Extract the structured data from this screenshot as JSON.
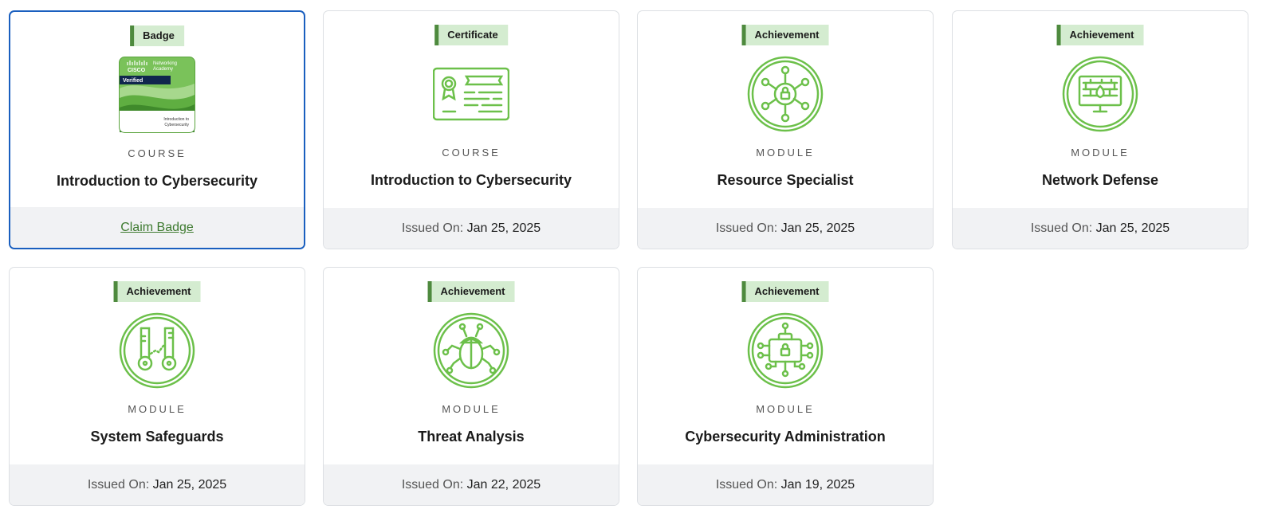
{
  "colors": {
    "accent_green": "#6cc04a",
    "tag_bg": "#d4ecd0",
    "tag_border": "#4e8a3e",
    "selected_border": "#1a5fbf",
    "link_green": "#3d7a2f"
  },
  "cards": [
    {
      "tag": "Badge",
      "icon": "cisco-verified-badge",
      "badge_brand": "Networking",
      "badge_brand2": "Academy",
      "badge_vendor": "CISCO",
      "badge_verified": "Verified",
      "badge_course1": "Introduction to",
      "badge_course2": "Cybersecurity",
      "category": "COURSE",
      "title": "Introduction to Cybersecurity",
      "action": "Claim Badge"
    },
    {
      "tag": "Certificate",
      "icon": "certificate-icon",
      "category": "COURSE",
      "title": "Introduction to Cybersecurity",
      "issued_label": "Issued On:",
      "issued_date": "Jan 25, 2025"
    },
    {
      "tag": "Achievement",
      "icon": "network-lock-icon",
      "category": "MODULE",
      "title": "Resource Specialist",
      "issued_label": "Issued On:",
      "issued_date": "Jan 25, 2025"
    },
    {
      "tag": "Achievement",
      "icon": "firewall-monitor-icon",
      "category": "MODULE",
      "title": "Network Defense",
      "issued_label": "Issued On:",
      "issued_date": "Jan 25, 2025"
    },
    {
      "tag": "Achievement",
      "icon": "keys-icon",
      "category": "MODULE",
      "title": "System Safeguards",
      "issued_label": "Issued On:",
      "issued_date": "Jan 25, 2025"
    },
    {
      "tag": "Achievement",
      "icon": "bug-icon",
      "category": "MODULE",
      "title": "Threat Analysis",
      "issued_label": "Issued On:",
      "issued_date": "Jan 22, 2025"
    },
    {
      "tag": "Achievement",
      "icon": "briefcase-lock-icon",
      "category": "MODULE",
      "title": "Cybersecurity Administration",
      "issued_label": "Issued On:",
      "issued_date": "Jan 19, 2025"
    }
  ]
}
